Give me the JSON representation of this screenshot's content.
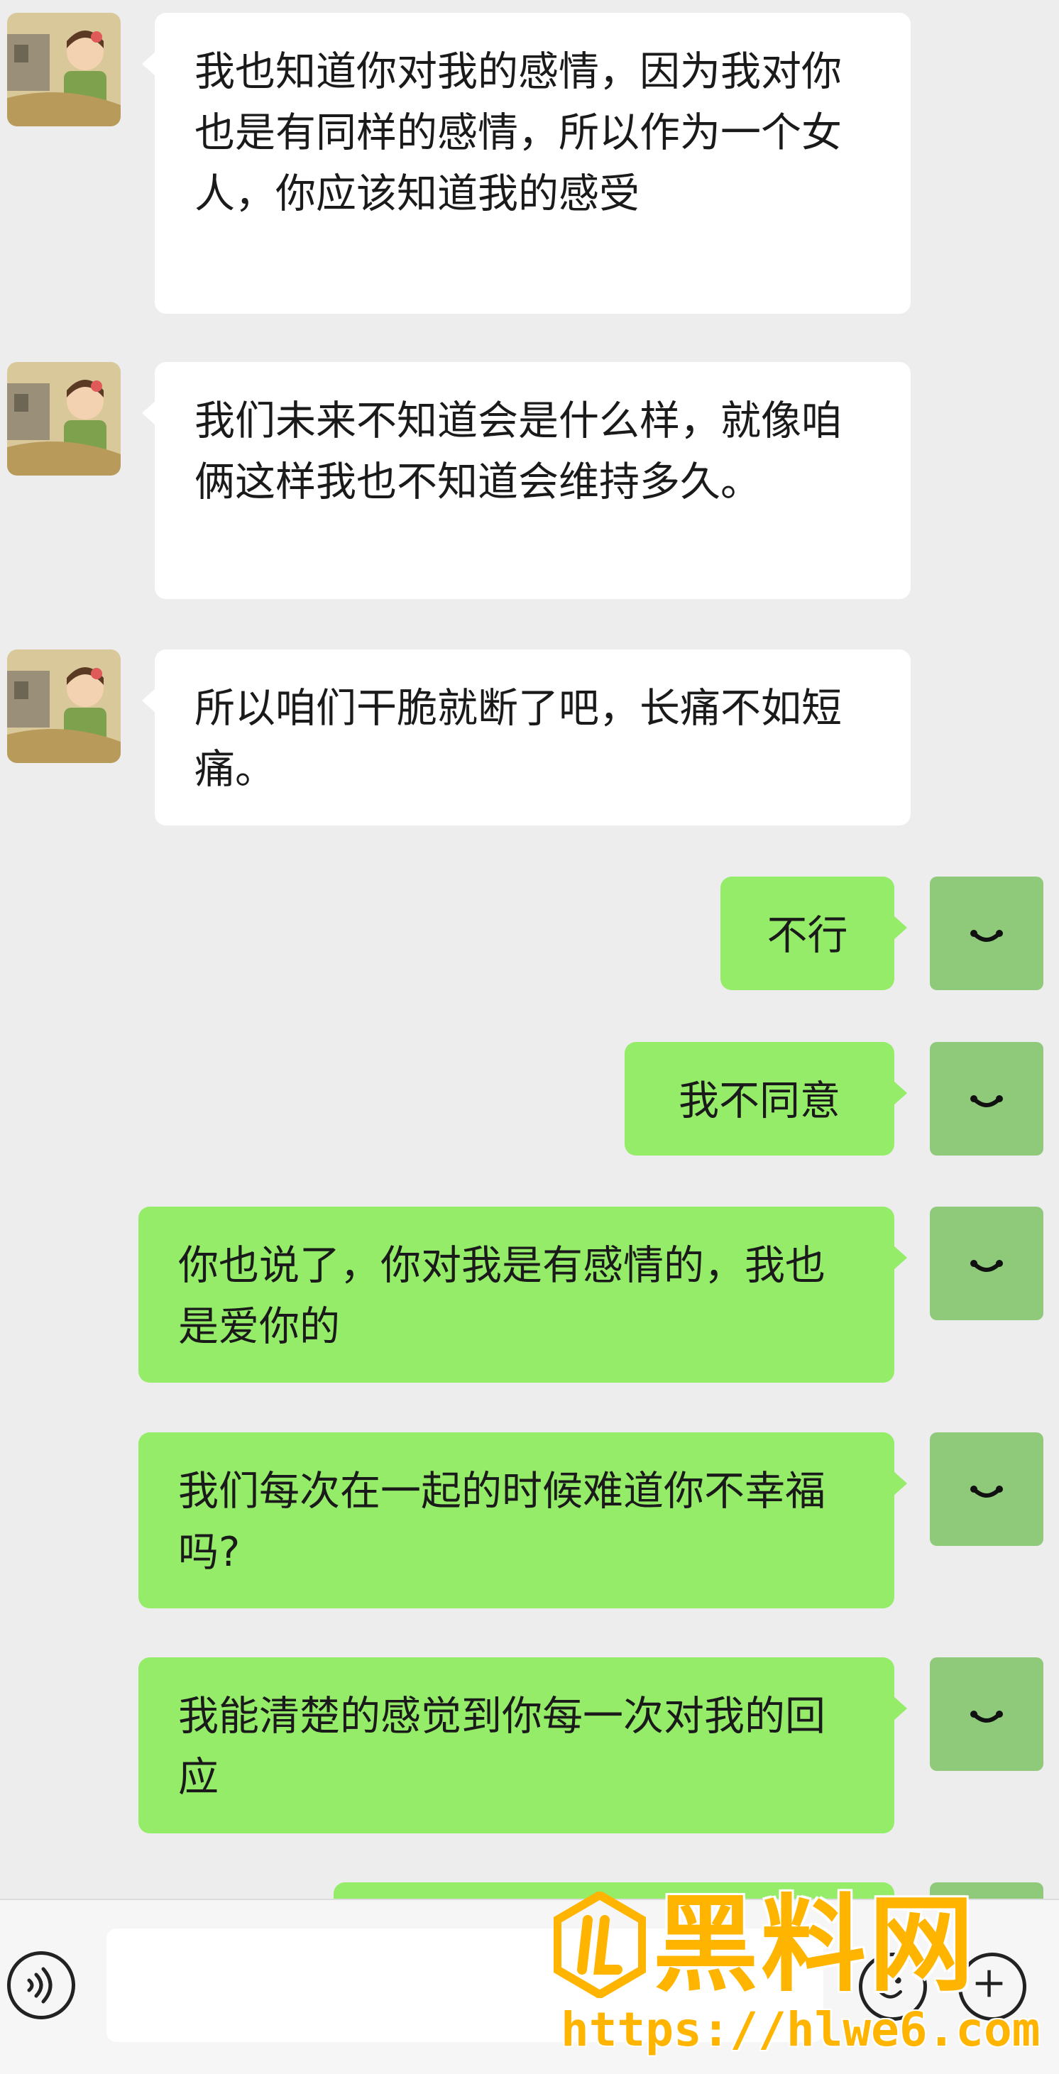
{
  "messages": [
    {
      "text": "我也知道你对我的感情，因为我对你也是有同样的感情，所以作为一个女人，你应该知道我的感受"
    },
    {
      "text": "我们未来不知道会是什么样，就像咱俩这样我也不知道会维持多久。"
    },
    {
      "text": "所以咱们干脆就断了吧，长痛不如短痛。"
    },
    {
      "text": "不行"
    },
    {
      "text": "我不同意"
    },
    {
      "text": "你也说了，你对我是有感情的，我也是爱你的"
    },
    {
      "text": "我们每次在一起的时候难道你不幸福吗?"
    },
    {
      "text": "我能清楚的感觉到你每一次对我的回应"
    },
    {
      "text": ""
    }
  ],
  "icons": {
    "contact_avatar": "avatar-girl-illustration",
    "my_avatar": "smile-face-icon",
    "voice": "voice-icon",
    "emoji": "emoji-icon",
    "plus": "plus-icon"
  },
  "colors": {
    "background": "#ededed",
    "incoming_bubble": "#ffffff",
    "outgoing_bubble": "#95ec69",
    "watermark": "#ffb400"
  },
  "watermark": {
    "title": "黑料网",
    "url": "https://hlwe6.com"
  }
}
